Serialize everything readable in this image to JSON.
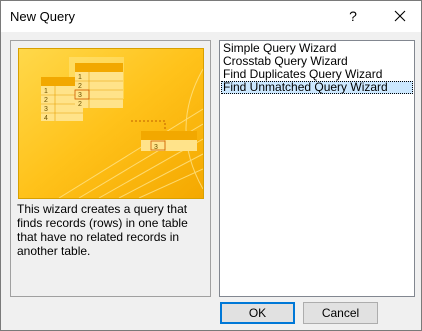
{
  "dialog": {
    "title": "New Query",
    "help_glyph": "?",
    "description": "This wizard creates a query that finds records (rows) in one table that have no related records in another table."
  },
  "illustration": {
    "left_table_rows": [
      "1",
      "2",
      "3",
      "4"
    ],
    "middle_table_rows": [
      "1",
      "2",
      "3",
      "2"
    ],
    "result_value": "3"
  },
  "wizards": [
    {
      "label": "Simple Query Wizard",
      "selected": false
    },
    {
      "label": "Crosstab Query Wizard",
      "selected": false
    },
    {
      "label": "Find Duplicates Query Wizard",
      "selected": false
    },
    {
      "label": "Find Unmatched Query Wizard",
      "selected": true
    }
  ],
  "buttons": {
    "ok": "OK",
    "cancel": "Cancel"
  },
  "colors": {
    "illustration_bg": "#ffc000",
    "selection": "#cce8ff",
    "default_button_border": "#0078d7"
  }
}
